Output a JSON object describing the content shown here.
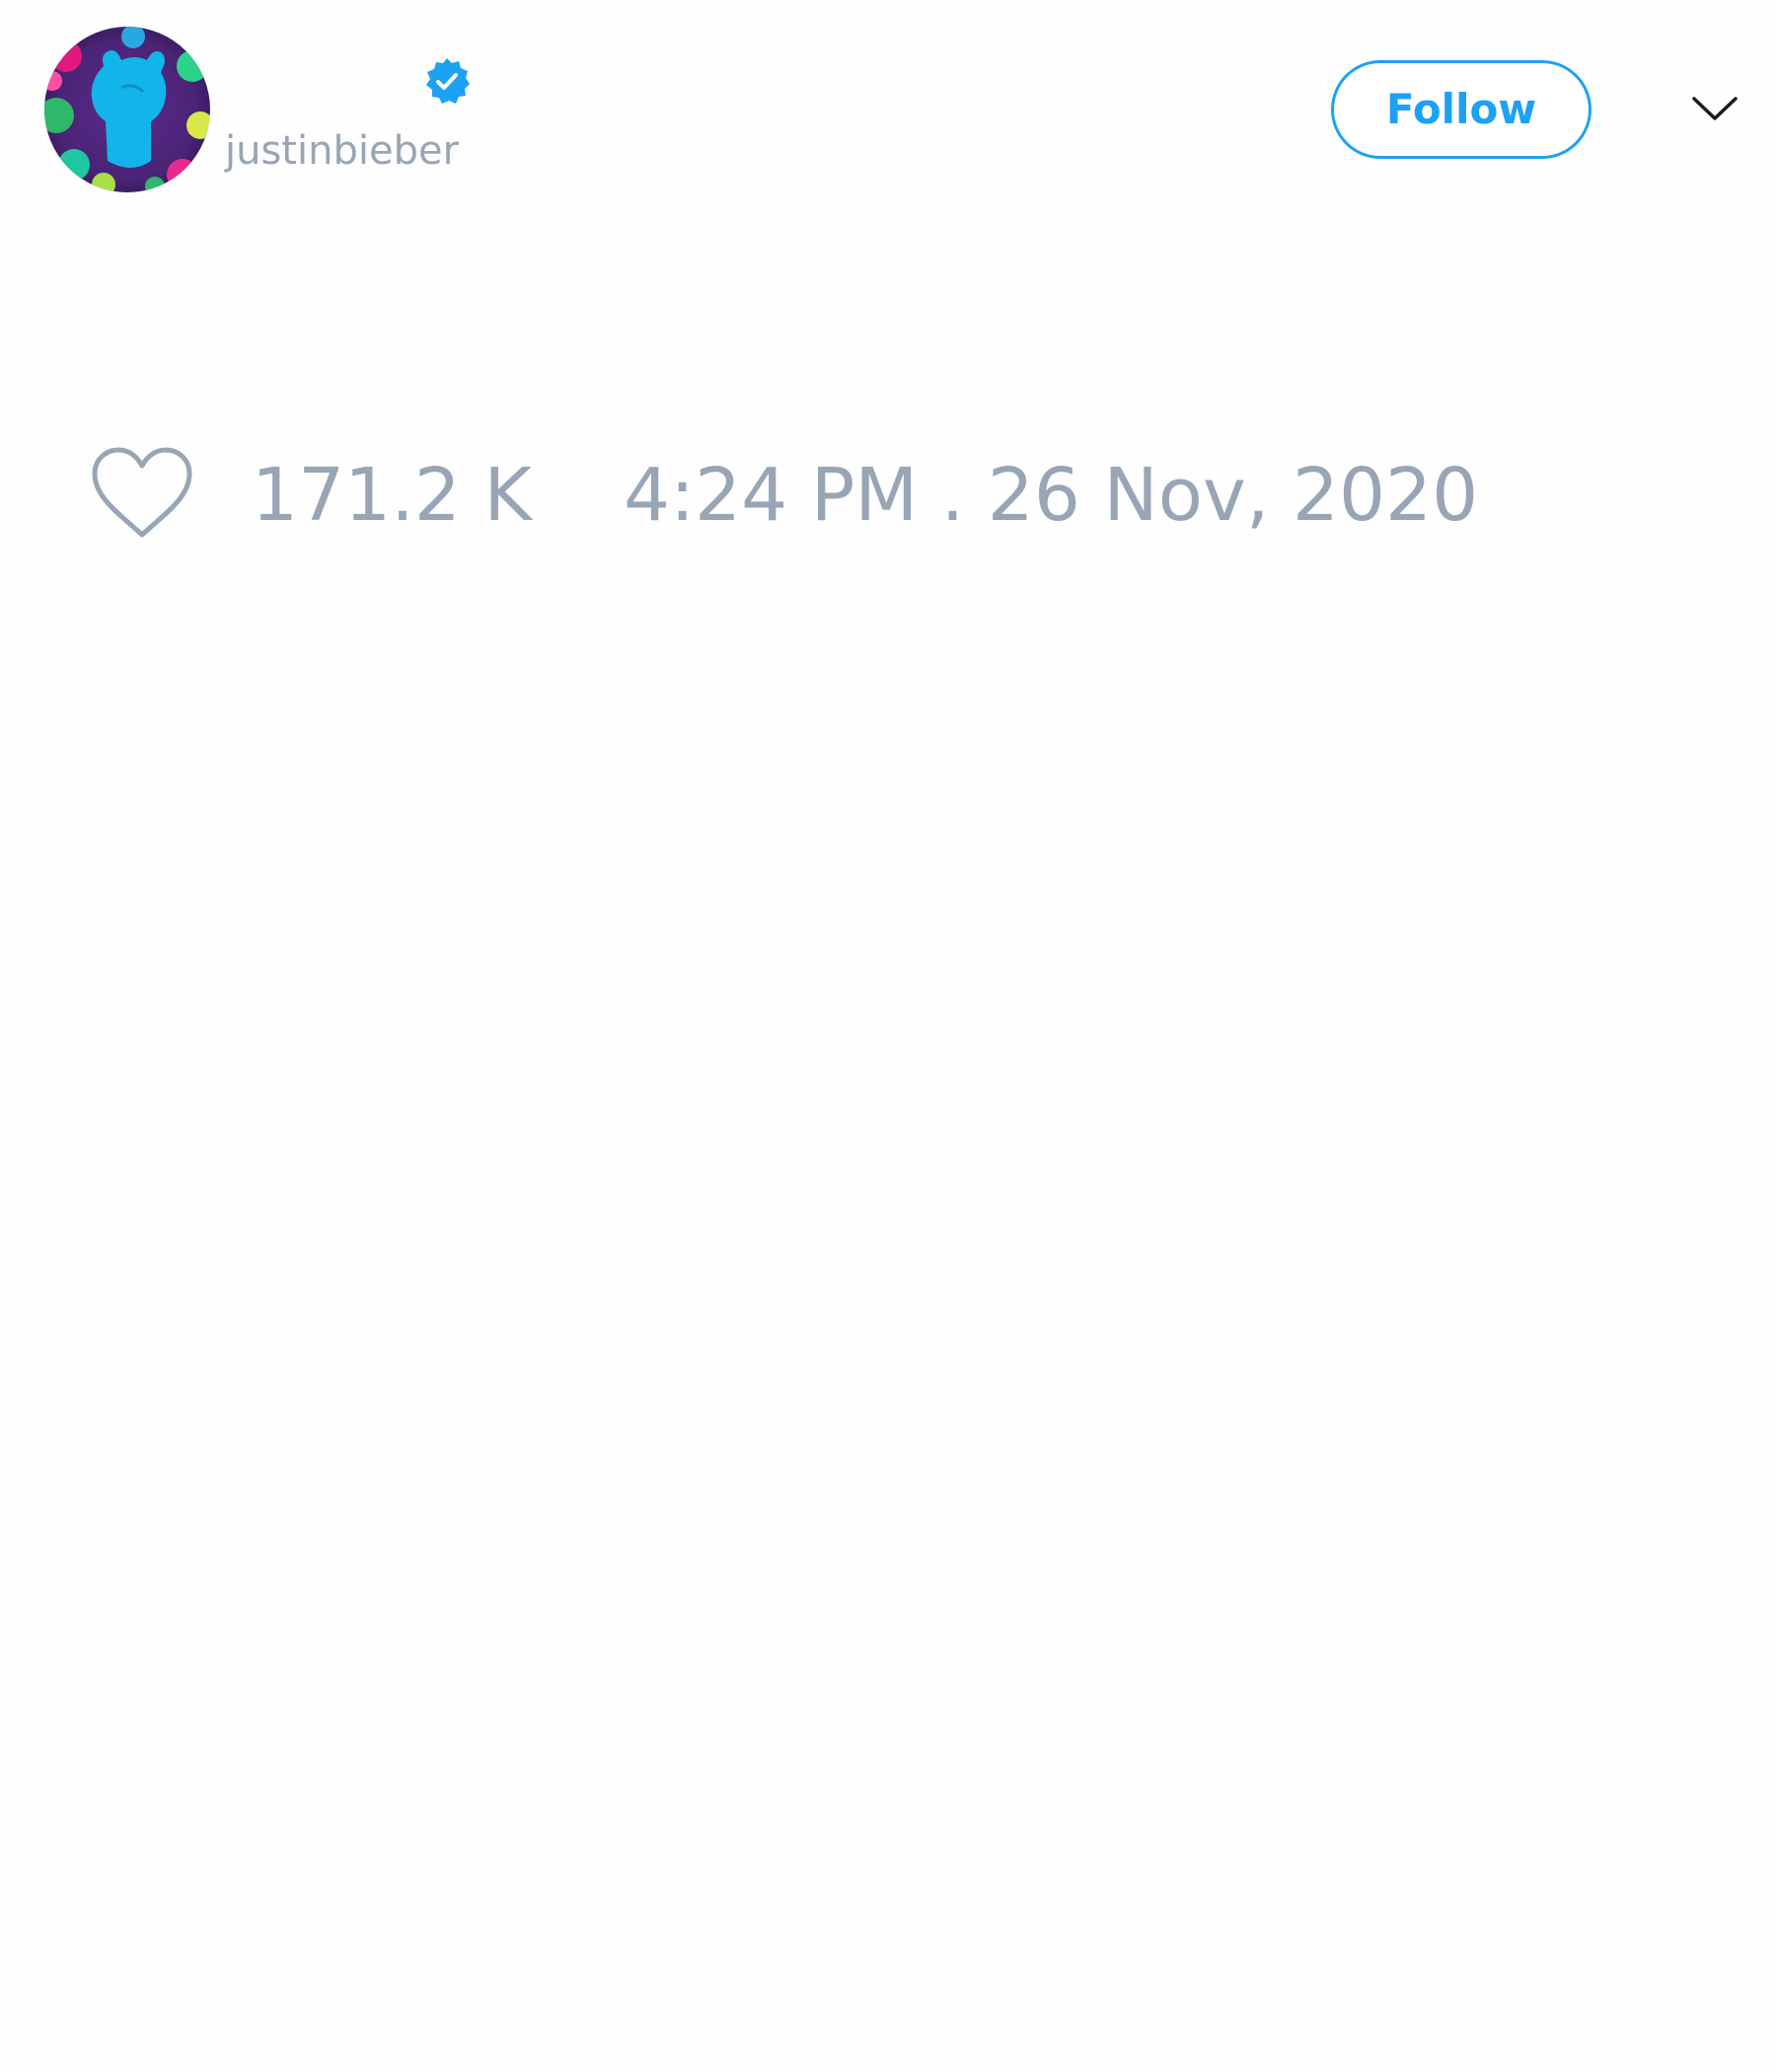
{
  "tweet": {
    "author": {
      "handle": "justinbieber",
      "verified": true,
      "avatar_icon": "profile-avatar"
    },
    "follow_label": "Follow",
    "menu_icon": "chevron-down-icon",
    "likes": {
      "icon": "heart-icon",
      "count": "171.2 K"
    },
    "timestamp": "4:24 PM . 26 Nov, 2020"
  },
  "colors": {
    "accent": "#1da1f2",
    "muted_text": "#98a5b5",
    "background": "#fefefe"
  }
}
